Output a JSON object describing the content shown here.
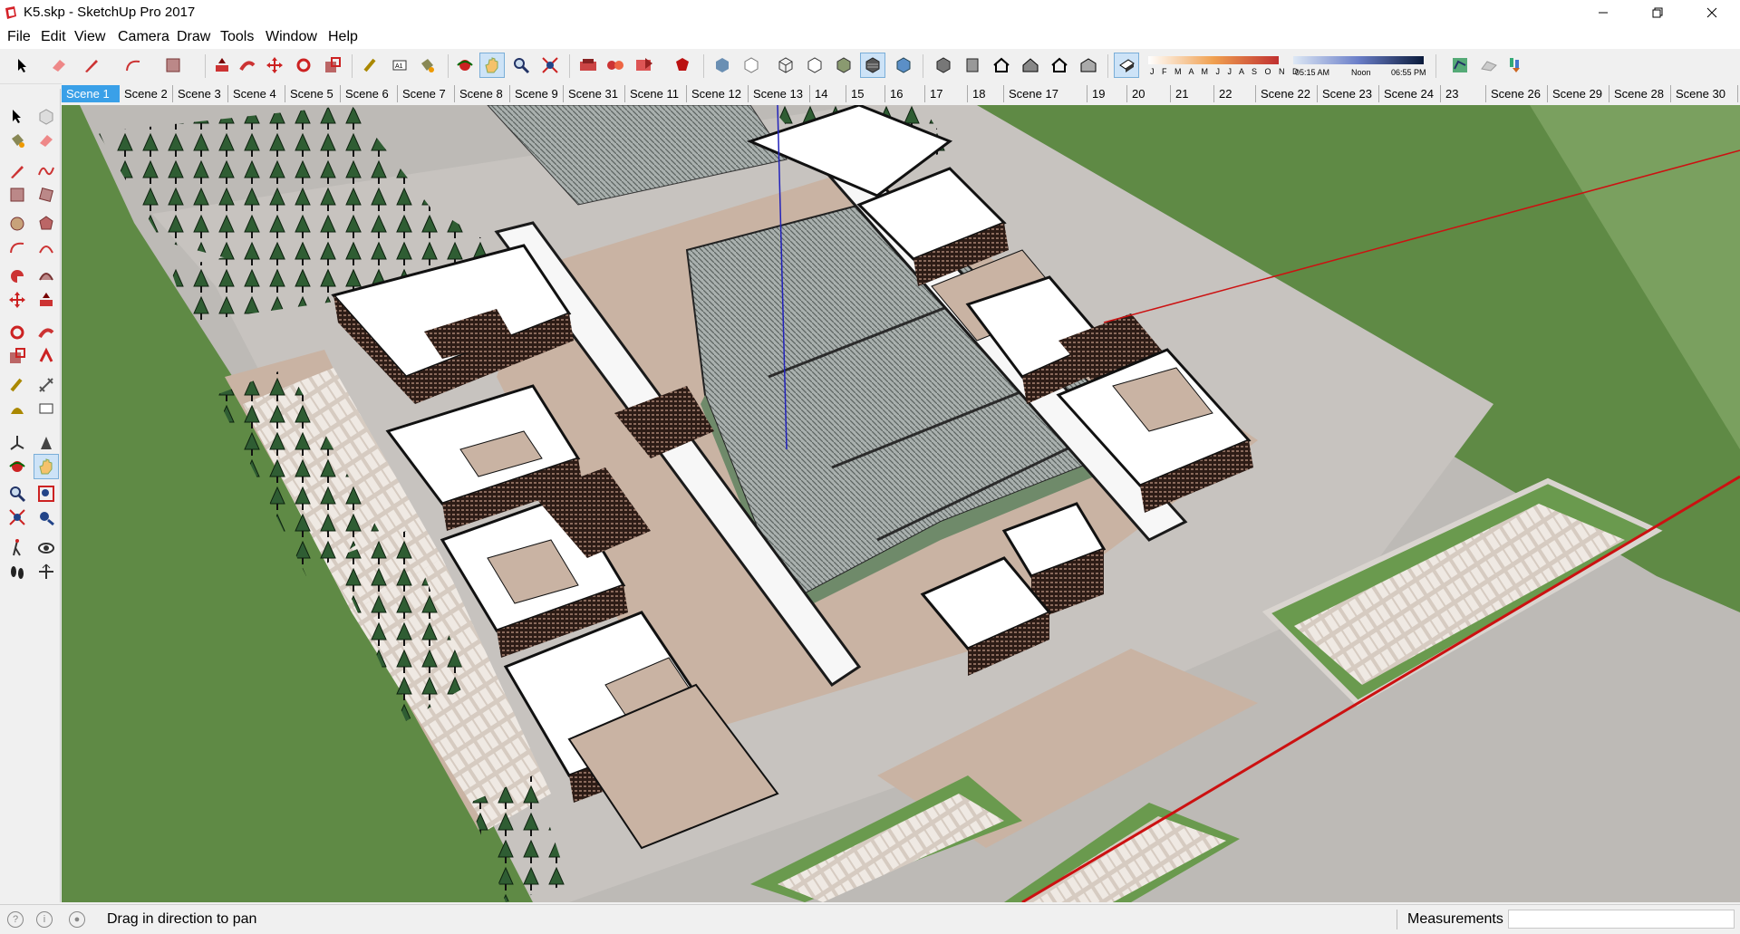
{
  "window": {
    "title": "K5.skp - SketchUp Pro 2017"
  },
  "menu": [
    "File",
    "Edit",
    "View",
    "Camera",
    "Draw",
    "Tools",
    "Window",
    "Help"
  ],
  "shadow": {
    "months": "J F M A M J J A S O N D",
    "time_start": "05:15 AM",
    "time_mid": "Noon",
    "time_end": "06:55 PM"
  },
  "scenes": [
    "Scene 1",
    "Scene 2",
    "Scene 3",
    "Scene 4",
    "Scene 5",
    "Scene 6",
    "Scene 7",
    "Scene 8",
    "Scene 9",
    "Scene 31",
    "Scene 11",
    "Scene 12",
    "Scene 13",
    "14",
    "15",
    "16",
    "17",
    "18",
    "Scene 17",
    "19",
    "20",
    "21",
    "22",
    "Scene 22",
    "Scene 23",
    "Scene 24",
    "23",
    "Scene 26",
    "Scene 29",
    "Scene 28",
    "Scene 30"
  ],
  "active_scene": "Scene 1",
  "status": {
    "hint": "Drag in direction to pan",
    "measurements_label": "Measurements",
    "measurements_value": ""
  },
  "colors": {
    "grass": "#5f8a45",
    "paving": "#c8c4bf",
    "plaza": "#c9b3a3",
    "roof": "#ffffff",
    "brick": "#5a3a2e",
    "glass": "#9aa3a3",
    "selected_tab": "#3aa0e8",
    "red_axis": "#cc1111",
    "blue_axis": "#2222bb"
  },
  "toolbar_icons": [
    "select-icon",
    "eraser-icon",
    "pencil-icon",
    "pushpull-icon",
    "paint-icon",
    "move-icon",
    "rotate-icon",
    "scale-icon",
    "tape-icon",
    "text-icon",
    "orbit-icon",
    "pan-icon",
    "zoom-icon",
    "zoom-extents-icon",
    "component-icon",
    "section-icon",
    "layers-icon",
    "home-icon",
    "shadow-icon",
    "geo-icon",
    "warehouse-icon",
    "extension-icon"
  ],
  "palette_icons": [
    "select-icon",
    "make-component-icon",
    "paint-bucket-icon",
    "eraser-icon",
    "line-icon",
    "freehand-icon",
    "rectangle-icon",
    "rotated-rectangle-icon",
    "circle-icon",
    "polygon-icon",
    "arc-icon",
    "two-point-arc-icon",
    "pie-icon",
    "three-point-arc-icon",
    "move-icon",
    "pushpull-icon",
    "rotate-icon",
    "follow-me-icon",
    "scale-icon",
    "offset-icon",
    "tape-measure-icon",
    "dimension-icon",
    "protractor-icon",
    "text-icon",
    "axes-icon",
    "3d-text-icon",
    "orbit-icon",
    "pan-icon",
    "zoom-icon",
    "zoom-window-icon",
    "zoom-extents-icon",
    "position-camera-icon",
    "walk-icon",
    "look-around-icon",
    "footprints-icon",
    "section-plane-icon"
  ]
}
